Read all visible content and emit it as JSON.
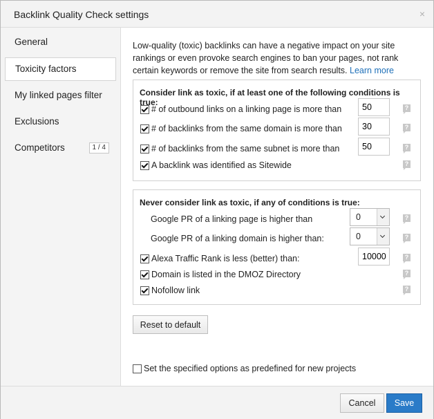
{
  "dialog": {
    "title": "Backlink Quality Check settings",
    "close_glyph": "×"
  },
  "sidebar": {
    "items": [
      {
        "label": "General"
      },
      {
        "label": "Toxicity factors"
      },
      {
        "label": "My linked pages filter"
      },
      {
        "label": "Exclusions"
      },
      {
        "label": "Competitors",
        "badge": "1 / 4"
      }
    ],
    "active_index": 1
  },
  "intro": {
    "text": "Low-quality (toxic) backlinks can have a negative impact on your site rankings or even provoke search engines to ban your pages, not rank certain keywords or remove the site from search results.",
    "link": "Learn more"
  },
  "toxic_group": {
    "title": "Consider link as toxic, if at least one of the following conditions is true:",
    "rows": [
      {
        "label": "# of outbound links on a linking page is more than",
        "checked": true,
        "value": "50"
      },
      {
        "label": "# of backlinks from the same domain is more than",
        "checked": true,
        "value": "30"
      },
      {
        "label": "# of backlinks from the same subnet is more than",
        "checked": true,
        "value": "50"
      },
      {
        "label": "A backlink was identified as Sitewide",
        "checked": true
      }
    ]
  },
  "never_group": {
    "title": "Never consider link as toxic, if any of conditions is true:",
    "rows": [
      {
        "label": "Google PR of a linking page is higher than",
        "select": "0"
      },
      {
        "label": "Google PR of a linking domain is higher than:",
        "select": "0"
      },
      {
        "label": "Alexa Traffic Rank is less (better) than:",
        "checked": true,
        "value": "10000"
      },
      {
        "label": "Domain is listed in the DMOZ Directory",
        "checked": true
      },
      {
        "label": "Nofollow link",
        "checked": true
      }
    ]
  },
  "help_glyph": "?",
  "buttons": {
    "reset": "Reset to default",
    "cancel": "Cancel",
    "save": "Save"
  },
  "predefined": {
    "label": "Set the specified options as predefined for new projects",
    "checked": false
  },
  "colors": {
    "accent": "#2a7bc8",
    "link": "#1d6fb8"
  }
}
